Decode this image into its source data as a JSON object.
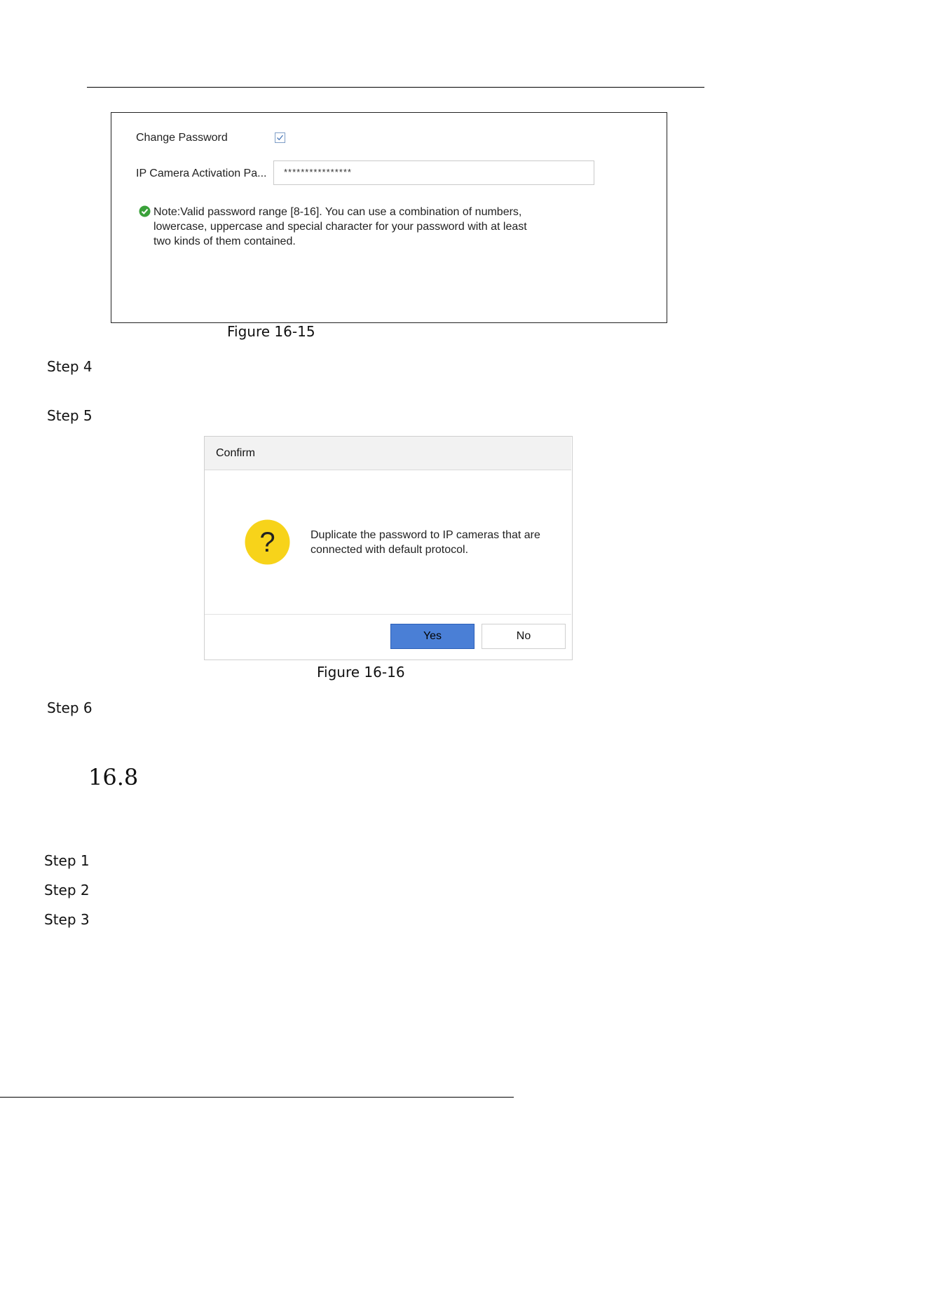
{
  "figure1": {
    "change_password_label": "Change Password",
    "change_password_checked": true,
    "activation_label": "IP Camera Activation Pa...",
    "activation_value": "****************",
    "note": "Note:Valid password range [8-16]. You can use a combination of numbers, lowercase, uppercase and special character for your password with at least two kinds of them contained.",
    "note_icon": "check-circle-icon",
    "caption": "Figure 16-15"
  },
  "steps_a": {
    "step4": "Step 4",
    "step5": "Step 5"
  },
  "dialog": {
    "title": "Confirm",
    "icon": "question-icon",
    "message": "Duplicate the password to IP cameras that are connected with default protocol.",
    "yes_label": "Yes",
    "no_label": "No",
    "caption": "Figure 16-16"
  },
  "steps_b": {
    "step6": "Step 6"
  },
  "section": {
    "number": "16.8"
  },
  "steps_c": {
    "step1": "Step 1",
    "step2": "Step 2",
    "step3": "Step 3"
  },
  "colors": {
    "yes_button": "#4a7fd6",
    "question_icon": "#f7d31a",
    "note_check": "#3aa13a"
  }
}
